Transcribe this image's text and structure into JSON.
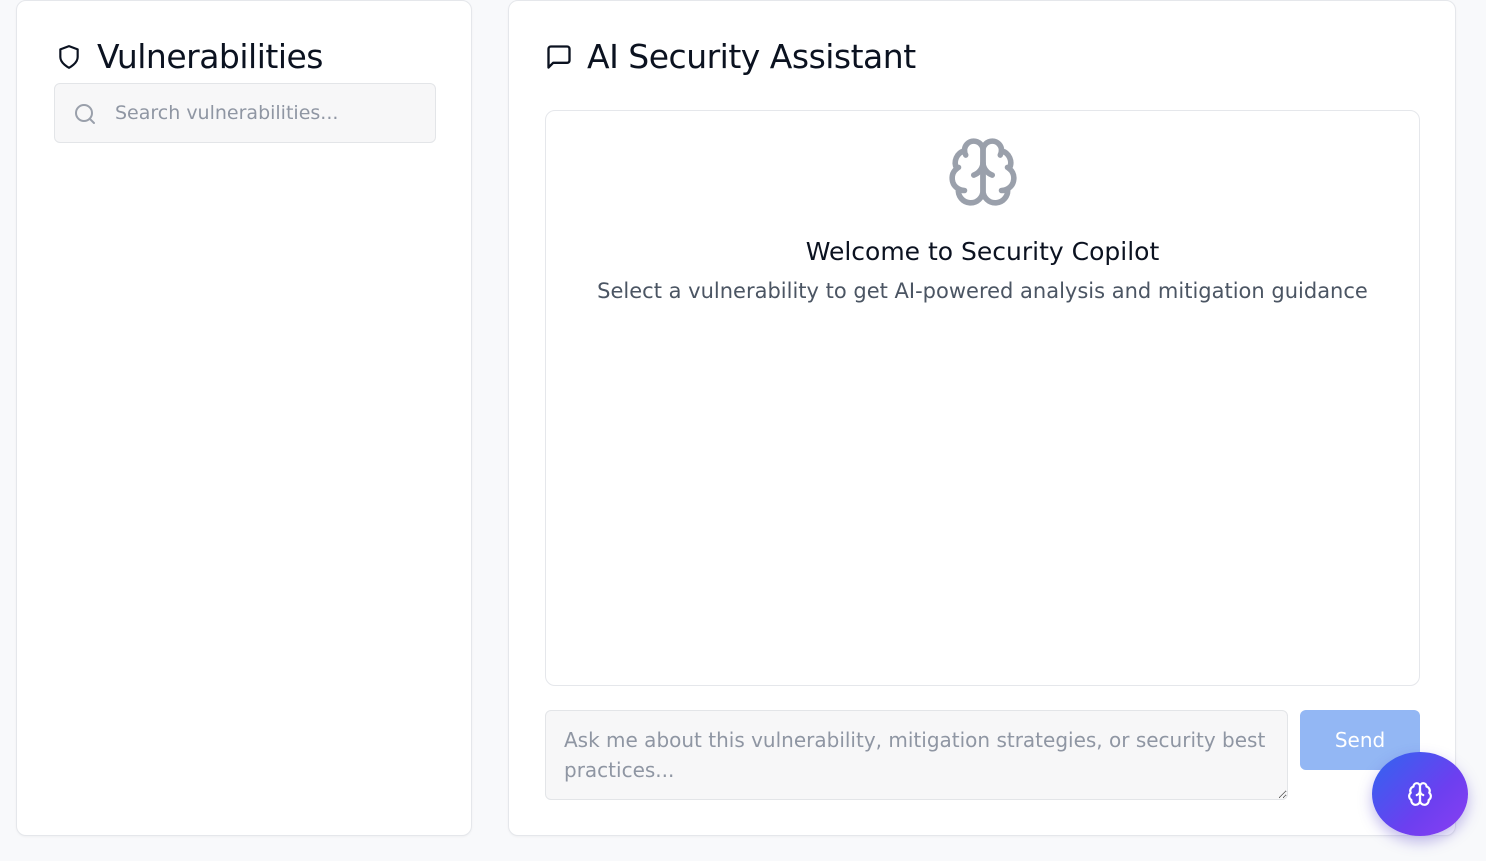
{
  "vulnerabilities_panel": {
    "title": "Vulnerabilities",
    "title_icon": "shield-icon",
    "search": {
      "icon": "search-icon",
      "placeholder": "Search vulnerabilities...",
      "value": ""
    }
  },
  "assistant_panel": {
    "title": "AI Security Assistant",
    "title_icon": "message-square-icon",
    "empty_state": {
      "icon": "brain-icon",
      "title": "Welcome to Security Copilot",
      "subtitle": "Select a vulnerability to get AI-powered analysis and mitigation guidance"
    },
    "message_input": {
      "placeholder": "Ask me about this vulnerability, mitigation strategies, or security best practices...",
      "value": ""
    },
    "send_label": "Send"
  },
  "fab": {
    "icon": "brain-icon"
  },
  "colors": {
    "background": "#f8f9fb",
    "send_button_disabled": "#93b7f4",
    "fab_gradient_start": "#2f66f0",
    "fab_gradient_end": "#8a3ff2",
    "icon_muted": "#9aa0ab"
  }
}
